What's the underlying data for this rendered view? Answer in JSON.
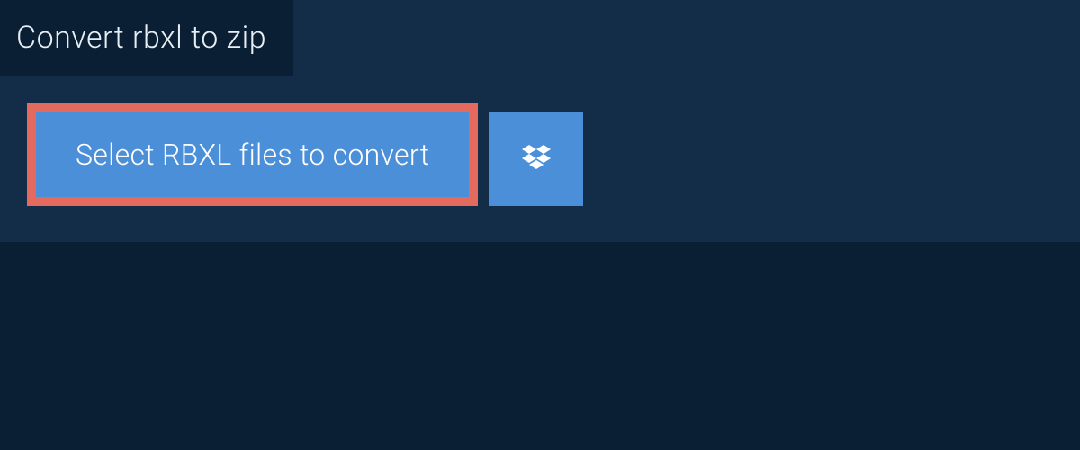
{
  "tab": {
    "label": "Convert rbxl to zip"
  },
  "actions": {
    "select_files_label": "Select RBXL files to convert"
  },
  "colors": {
    "background": "#0a1f33",
    "panel": "#132d49",
    "button": "#4a8fd8",
    "highlight_border": "#e36a5c",
    "text_light": "#e8eef5",
    "text_white": "#ffffff"
  }
}
